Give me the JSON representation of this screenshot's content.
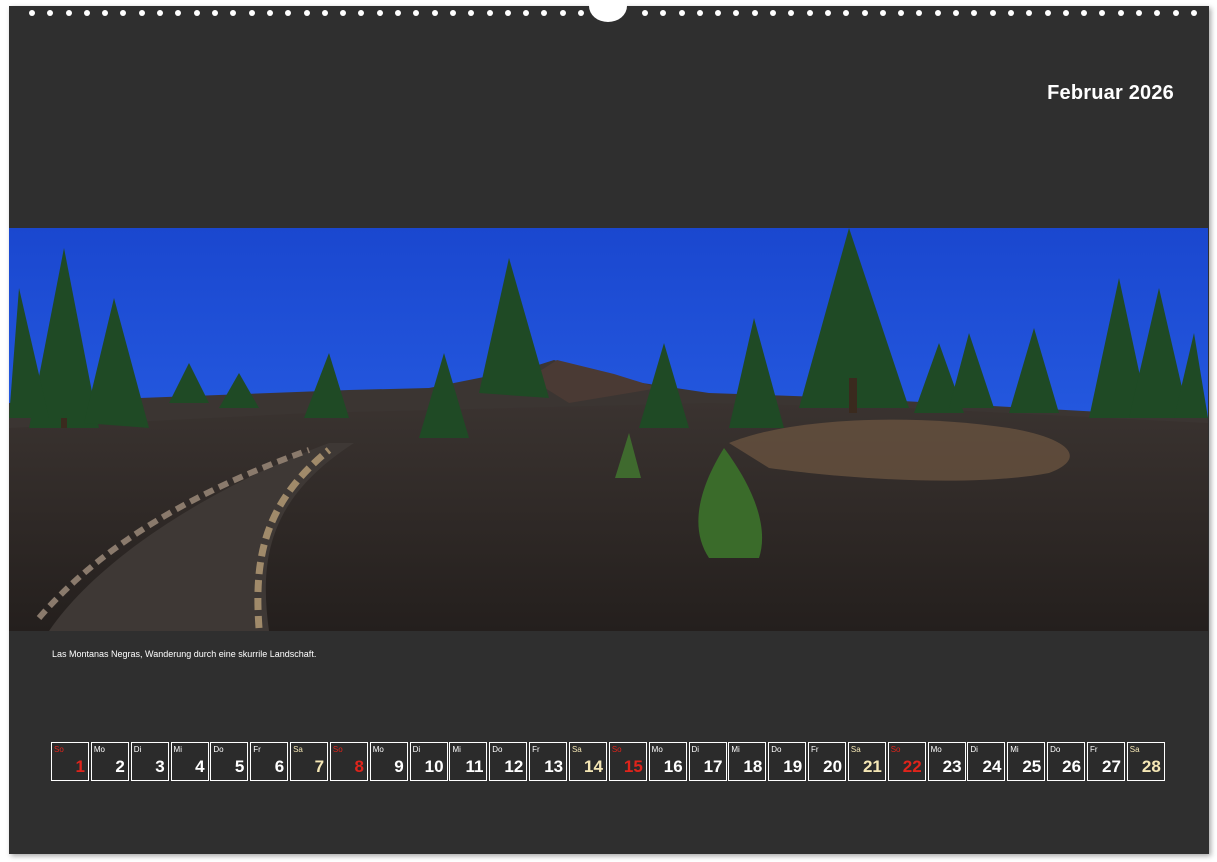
{
  "calendar": {
    "title": "Februar 2026",
    "caption": "Las Montanas Negras, Wanderung durch eine skurrile Landschaft.",
    "colors": {
      "page_background": "#2f2f2f",
      "sunday": "#e0241b",
      "saturday": "#f5e7b5",
      "weekday": "#ffffff",
      "sky": "#1e4fd6",
      "lava_ground": "#2a2624"
    },
    "days": [
      {
        "wd": "So",
        "num": "1",
        "type": "sun"
      },
      {
        "wd": "Mo",
        "num": "2",
        "type": "wk"
      },
      {
        "wd": "Di",
        "num": "3",
        "type": "wk"
      },
      {
        "wd": "Mi",
        "num": "4",
        "type": "wk"
      },
      {
        "wd": "Do",
        "num": "5",
        "type": "wk"
      },
      {
        "wd": "Fr",
        "num": "6",
        "type": "wk"
      },
      {
        "wd": "Sa",
        "num": "7",
        "type": "sat"
      },
      {
        "wd": "So",
        "num": "8",
        "type": "sun"
      },
      {
        "wd": "Mo",
        "num": "9",
        "type": "wk"
      },
      {
        "wd": "Di",
        "num": "10",
        "type": "wk"
      },
      {
        "wd": "Mi",
        "num": "11",
        "type": "wk"
      },
      {
        "wd": "Do",
        "num": "12",
        "type": "wk"
      },
      {
        "wd": "Fr",
        "num": "13",
        "type": "wk"
      },
      {
        "wd": "Sa",
        "num": "14",
        "type": "sat"
      },
      {
        "wd": "So",
        "num": "15",
        "type": "sun"
      },
      {
        "wd": "Mo",
        "num": "16",
        "type": "wk"
      },
      {
        "wd": "Di",
        "num": "17",
        "type": "wk"
      },
      {
        "wd": "Mi",
        "num": "18",
        "type": "wk"
      },
      {
        "wd": "Do",
        "num": "19",
        "type": "wk"
      },
      {
        "wd": "Fr",
        "num": "20",
        "type": "wk"
      },
      {
        "wd": "Sa",
        "num": "21",
        "type": "sat"
      },
      {
        "wd": "So",
        "num": "22",
        "type": "sun"
      },
      {
        "wd": "Mo",
        "num": "23",
        "type": "wk"
      },
      {
        "wd": "Di",
        "num": "24",
        "type": "wk"
      },
      {
        "wd": "Mi",
        "num": "25",
        "type": "wk"
      },
      {
        "wd": "Do",
        "num": "26",
        "type": "wk"
      },
      {
        "wd": "Fr",
        "num": "27",
        "type": "wk"
      },
      {
        "wd": "Sa",
        "num": "28",
        "type": "sat"
      }
    ]
  }
}
